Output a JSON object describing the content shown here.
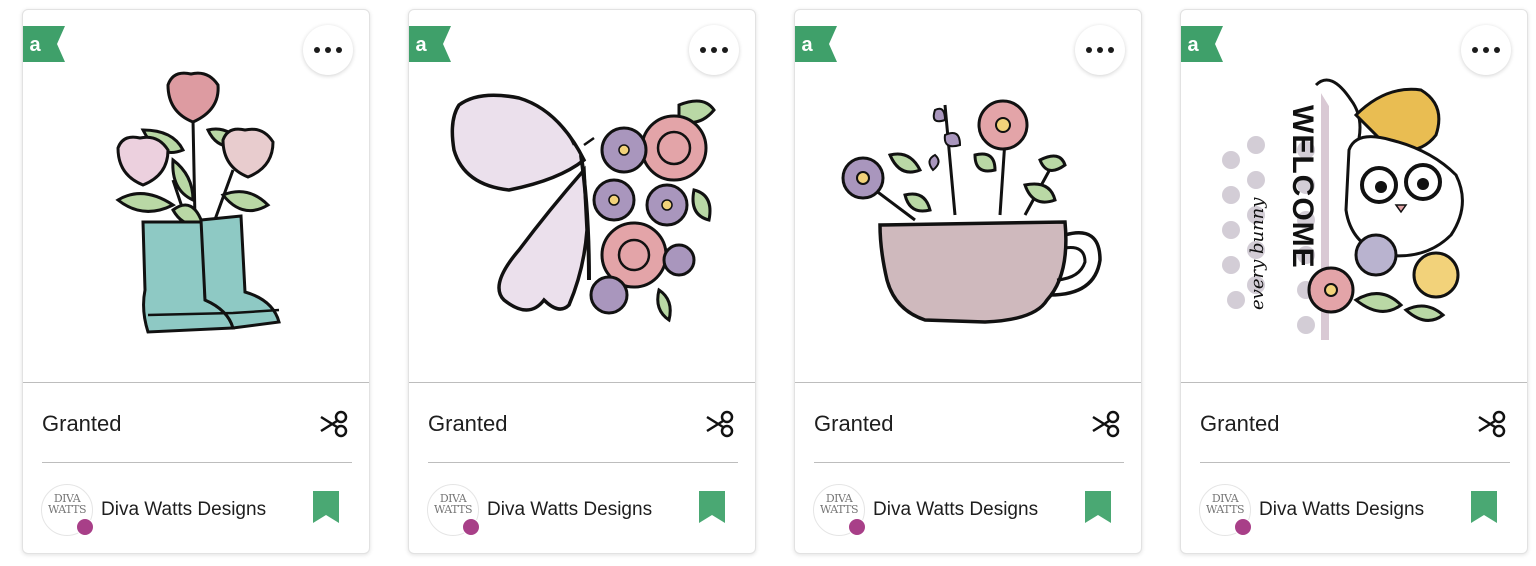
{
  "cards": [
    {
      "title": "Granted",
      "author": "Diva Watts Designs",
      "avatar_text": "DIVA WATTS",
      "badge_letter": "a",
      "image": "rain-boots-tulips"
    },
    {
      "title": "Granted",
      "author": "Diva Watts Designs",
      "avatar_text": "DIVA WATTS",
      "badge_letter": "a",
      "image": "butterfly-roses"
    },
    {
      "title": "Granted",
      "author": "Diva Watts Designs",
      "avatar_text": "DIVA WATTS",
      "badge_letter": "a",
      "image": "teacup-flowers"
    },
    {
      "title": "Granted",
      "author": "Diva Watts Designs",
      "avatar_text": "DIVA WATTS",
      "badge_letter": "a",
      "image": "welcome-bunny-sign",
      "sign_text": "WELCOME",
      "script_text": "every bunny"
    }
  ],
  "colors": {
    "badge": "#3fa06a",
    "bookmark": "#4aa873",
    "divider": "#bdbdbd"
  }
}
